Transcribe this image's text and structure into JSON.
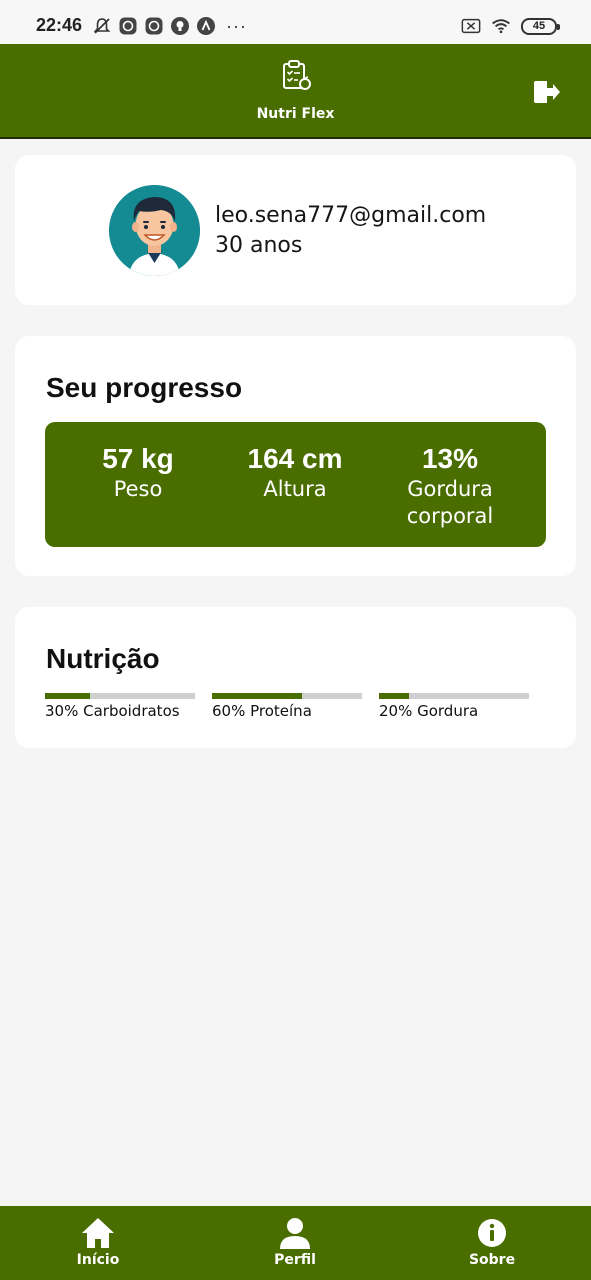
{
  "status_bar": {
    "time": "22:46",
    "more": "···",
    "battery": "45",
    "icons": [
      "mute-icon",
      "app-icon",
      "app-icon",
      "bulb-icon",
      "a-icon",
      "no-sim-icon",
      "wifi-icon",
      "battery-icon"
    ]
  },
  "header": {
    "title": "Nutri Flex",
    "logo_icon": "clipboard-apple-icon",
    "logout_icon": "logout-icon"
  },
  "profile": {
    "email": "leo.sena777@gmail.com",
    "age": "30 anos",
    "avatar_icon": "avatar-man-icon"
  },
  "progress": {
    "title": "Seu progresso",
    "stats": [
      {
        "value": "57 kg",
        "label": "Peso"
      },
      {
        "value": "164 cm",
        "label": "Altura"
      },
      {
        "value": "13%",
        "label": "Gordura corporal"
      }
    ]
  },
  "nutrition": {
    "title": "Nutrição",
    "items": [
      {
        "label": "30% Carboidratos",
        "percent": 30
      },
      {
        "label": "60% Proteína",
        "percent": 60
      },
      {
        "label": "20% Gordura",
        "percent": 20
      }
    ]
  },
  "bottom_nav": {
    "items": [
      {
        "label": "Início",
        "icon": "home-icon"
      },
      {
        "label": "Perfil",
        "icon": "person-icon"
      },
      {
        "label": "Sobre",
        "icon": "info-icon"
      }
    ]
  },
  "colors": {
    "primary": "#4a6d00",
    "background": "#f5f5f5",
    "card": "#ffffff",
    "bar_track": "#cfcfcf"
  }
}
